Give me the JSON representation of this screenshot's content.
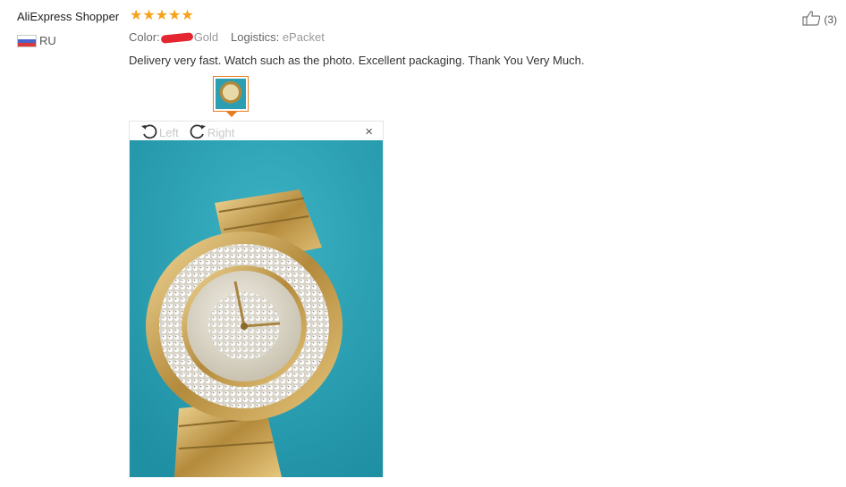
{
  "reviewer": {
    "name": "AliExpress Shopper",
    "country": "RU",
    "rating": 5
  },
  "order": {
    "color_label": "Color:",
    "color_value": "Gold",
    "logistics_label": "Logistics:",
    "logistics_value": "ePacket"
  },
  "review": {
    "text": "Delivery very fast. Watch such as the photo. Excellent packaging. Thank You Very Much."
  },
  "helpful": {
    "count": "(3)"
  },
  "viewer": {
    "rotate_left_label": "Left",
    "rotate_right_label": "Right",
    "close_label": "×"
  },
  "icons": [
    "star-icon",
    "russia-flag-icon",
    "thumbs-up-icon",
    "rotate-left-icon",
    "rotate-right-icon",
    "close-icon"
  ],
  "colors": {
    "star": "#f7a21b",
    "thumbnail_border": "#e67e22",
    "photo_background": "#2ea3b6"
  }
}
